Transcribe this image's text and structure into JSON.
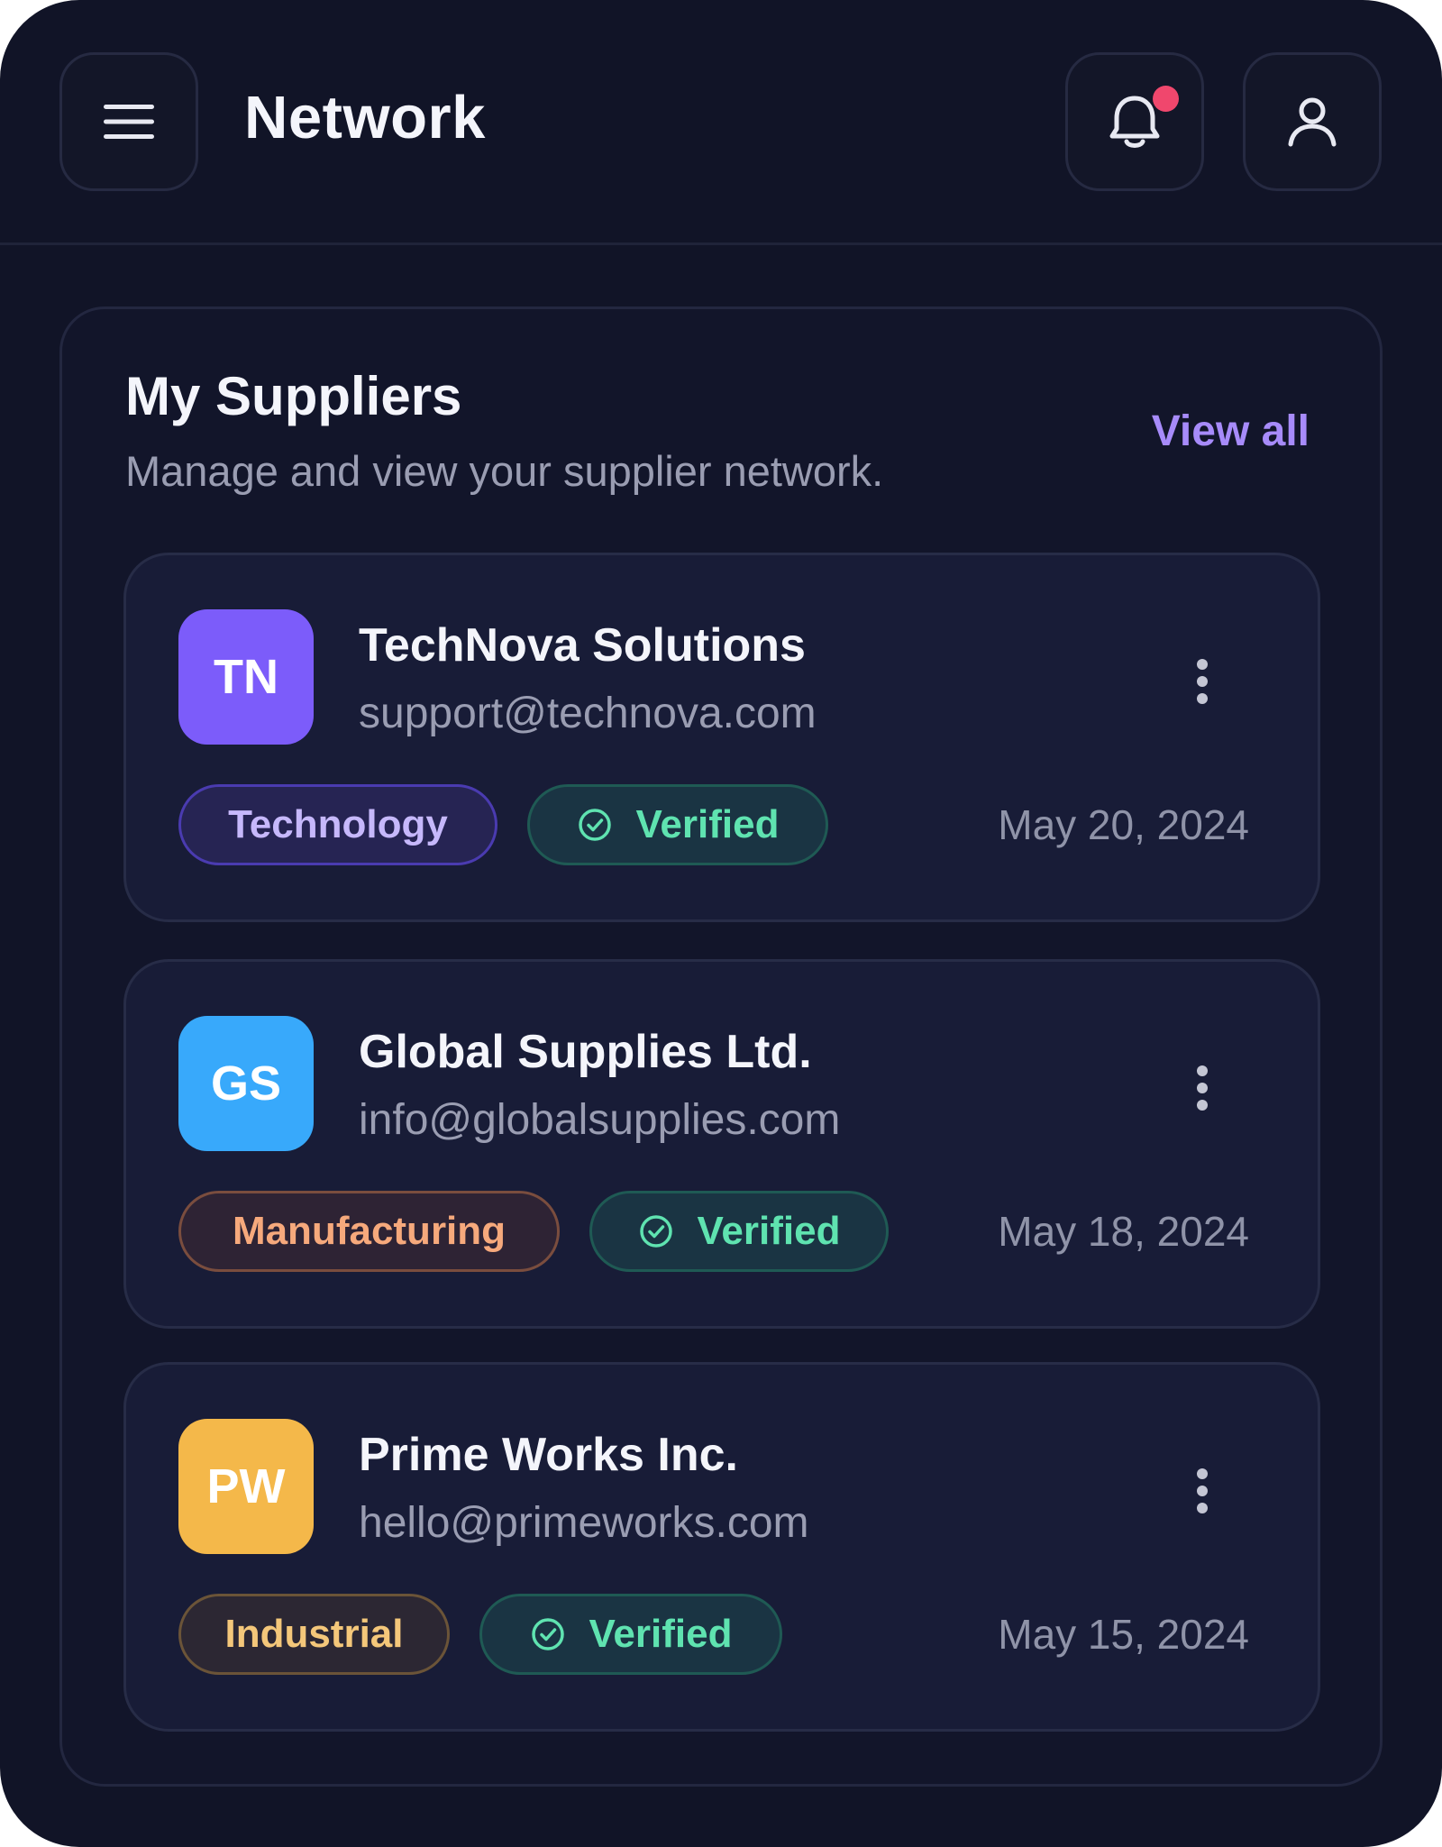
{
  "header": {
    "title": "Network",
    "menu_icon": "menu-icon",
    "bell_icon": "bell-icon",
    "user_icon": "user-icon",
    "has_notification": true
  },
  "panel": {
    "title": "My Suppliers",
    "subtitle": "Manage and view your supplier network.",
    "view_all": "View all"
  },
  "suppliers": [
    {
      "initials": "TN",
      "name": "TechNova Solutions",
      "email": "support@technova.com",
      "category": "Technology",
      "status": "Verified",
      "date": "May 20, 2024",
      "avatar_color": "#7c5cfa"
    },
    {
      "initials": "GS",
      "name": "Global Supplies Ltd.",
      "email": "info@globalsupplies.com",
      "category": "Manufacturing",
      "status": "Verified",
      "date": "May 18, 2024",
      "avatar_color": "#38a9fb"
    },
    {
      "initials": "PW",
      "name": "Prime Works Inc.",
      "email": "hello@primeworks.com",
      "category": "Industrial",
      "status": "Verified",
      "date": "May 15, 2024",
      "avatar_color": "#f4b84a"
    }
  ],
  "colors": {
    "background": "#111427",
    "accent": "#a78bfa",
    "verified": "#5fe3b0",
    "notification": "#f0476d"
  }
}
